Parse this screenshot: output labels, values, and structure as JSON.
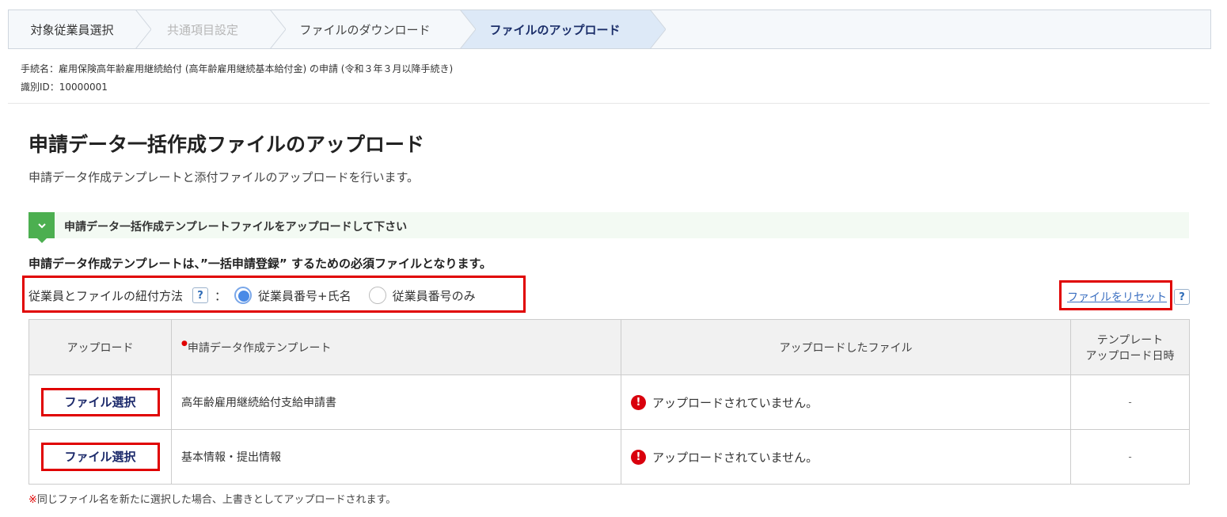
{
  "stepper": {
    "steps": [
      {
        "label": "対象従業員選択",
        "state": "done"
      },
      {
        "label": "共通項目設定",
        "state": "disabled"
      },
      {
        "label": "ファイルのダウンロード",
        "state": "done"
      },
      {
        "label": "ファイルのアップロード",
        "state": "active"
      }
    ]
  },
  "meta": {
    "procedure": "手続名：雇用保険高年齢雇用継続給付 (高年齢雇用継続基本給付金) の申請 (令和３年３月以降手続き)",
    "id": "識別ID：10000001"
  },
  "page": {
    "title": "申請データ一括作成ファイルのアップロード",
    "description": "申請データ作成テンプレートと添付ファイルのアップロードを行います。"
  },
  "banner": {
    "icon": "chevron-down-icon",
    "text": "申請データ一括作成テンプレートファイルをアップロードして下さい"
  },
  "note": "申請データ作成テンプレートは、”一括申請登録” するための必須ファイルとなります。",
  "link_method": {
    "label": "従業員とファイルの紐付方法",
    "help": "?",
    "colon": "：",
    "options": [
      {
        "label": "従業員番号+氏名",
        "selected": true
      },
      {
        "label": "従業員番号のみ",
        "selected": false
      }
    ]
  },
  "reset": {
    "label": "ファイルをリセット",
    "help": "?"
  },
  "table": {
    "headers": {
      "upload": "アップロード",
      "required_mark": "●",
      "template": "申請データ作成テンプレート",
      "uploaded_file": "アップロードしたファイル",
      "date_line1": "テンプレート",
      "date_line2": "アップロード日時"
    },
    "rows": [
      {
        "button": "ファイル選択",
        "template": "高年齢雇用継続給付支給申請書",
        "status_icon": "!",
        "status": "アップロードされていません。",
        "date": "-"
      },
      {
        "button": "ファイル選択",
        "template": "基本情報・提出情報",
        "status_icon": "!",
        "status": "アップロードされていません。",
        "date": "-"
      }
    ]
  },
  "footnote": {
    "mark": "※",
    "text": "同じファイル名を新たに選択した場合、上書きとしてアップロードされます。"
  },
  "colors": {
    "accent": "#e00000",
    "active_step": "#dde9f7",
    "banner_green": "#4caf50",
    "radio_selected": "#4a8ae6"
  }
}
